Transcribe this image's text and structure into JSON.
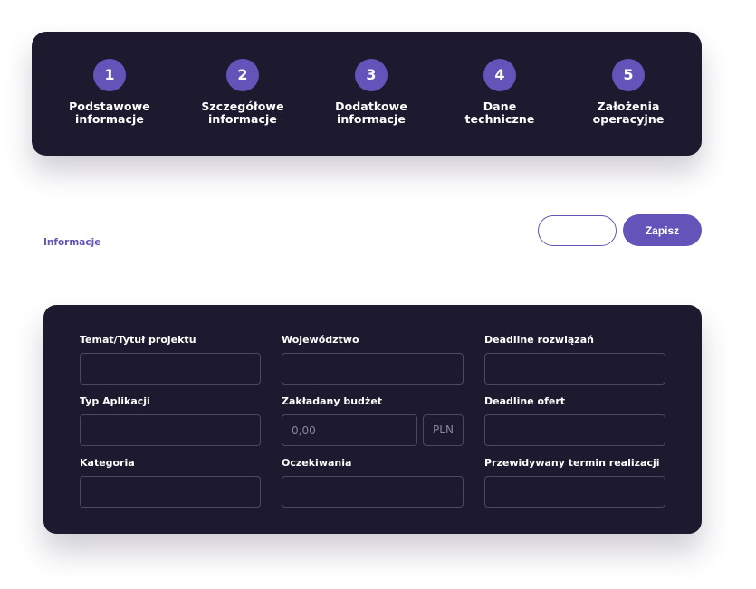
{
  "steps": [
    {
      "number": "1",
      "label": "Podstawowe informacje"
    },
    {
      "number": "2",
      "label": "Szczegółowe informacje"
    },
    {
      "number": "3",
      "label": "Dodatkowe informacje"
    },
    {
      "number": "4",
      "label": "Dane techniczne"
    },
    {
      "number": "5",
      "label": "Założenia operacyjne"
    }
  ],
  "header": {
    "section_label": "Informacje",
    "cancel_label": "",
    "save_label": "Zapisz"
  },
  "form": {
    "project_title": {
      "label": "Temat/Tytuł projektu",
      "value": ""
    },
    "voivodeship": {
      "label": "Województwo",
      "value": ""
    },
    "solutions_deadline": {
      "label": "Deadline rozwiązań",
      "value": ""
    },
    "app_type": {
      "label": "Typ Aplikacji",
      "value": ""
    },
    "budget": {
      "label": "Zakładany budżet",
      "placeholder": "0,00",
      "value": "",
      "currency": "PLN"
    },
    "offers_deadline": {
      "label": "Deadline ofert",
      "value": ""
    },
    "category": {
      "label": "Kategoria",
      "value": ""
    },
    "expectations": {
      "label": "Oczekiwania",
      "value": ""
    },
    "planned_completion": {
      "label": "Przewidywany termin realizacji",
      "value": ""
    }
  },
  "colors": {
    "accent": "#6453b8",
    "card_bg": "#1d1a2f",
    "input_border": "#4b4862"
  }
}
